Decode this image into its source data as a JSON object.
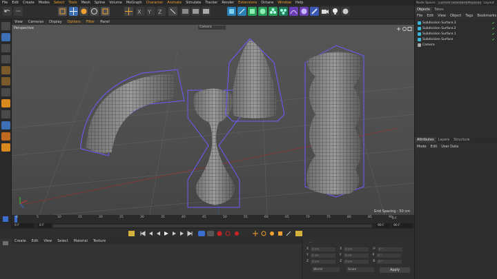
{
  "menubar": {
    "items": [
      "File",
      "Edit",
      "Create",
      "Modes",
      "Select",
      "Tools",
      "Mesh",
      "Spline",
      "Volume",
      "MoGraph",
      "Character",
      "Animate",
      "Simulate",
      "Tracker",
      "Render",
      "Extensions",
      "Octane",
      "Window",
      "Help"
    ],
    "highlighted": [
      "Select",
      "Tools",
      "Character",
      "Animate",
      "Extensions",
      "Window"
    ],
    "node_space_label": "Node Space:",
    "node_space_value": "Current (Standard/Physical)",
    "layout_label": "Layout"
  },
  "viewport": {
    "menus": [
      "View",
      "Cameras",
      "Display",
      "Options",
      "Filter",
      "Panel"
    ],
    "highlighted": [
      "Options",
      "Filter"
    ],
    "label": "Perspective",
    "camera_select": "Camera",
    "grid_spacing": "Grid Spacing : 50 cm"
  },
  "timeline": {
    "ticks": [
      "0",
      "5",
      "10",
      "15",
      "20",
      "25",
      "30",
      "35",
      "40",
      "45",
      "50",
      "55",
      "60",
      "65",
      "70",
      "75",
      "80",
      "85",
      "90"
    ],
    "current_frame": "0 F",
    "start": "0 F",
    "start2": "0 F",
    "end": "90 F",
    "end2": "90 F"
  },
  "material_bar": {
    "menus": [
      "Create",
      "Edit",
      "View",
      "Select",
      "Material",
      "Texture"
    ]
  },
  "coordinates": {
    "rows": [
      {
        "a": "X",
        "av": "0 cm",
        "b": "X",
        "bv": "0 cm",
        "c": "H",
        "cv": "0 °"
      },
      {
        "a": "Y",
        "av": "0 cm",
        "b": "Y",
        "bv": "0 cm",
        "c": "P",
        "cv": "0 °"
      },
      {
        "a": "Z",
        "av": "0 cm",
        "b": "Z",
        "bv": "0 cm",
        "c": "B",
        "cv": "0 °"
      }
    ],
    "mode1": "World",
    "mode2": "Scale",
    "apply": "Apply",
    "dots": "..."
  },
  "objects_panel": {
    "tabs": [
      "Objects",
      "Takes"
    ],
    "menus": [
      "File",
      "Edit",
      "View",
      "Object",
      "Tags",
      "Bookmarks"
    ],
    "items": [
      "Subdivision Surface.3",
      "Subdivision Surface.2",
      "Subdivision Surface.1",
      "Subdivision Surface",
      "Camera"
    ]
  },
  "attributes_panel": {
    "tabs": [
      "Attributes",
      "Layers",
      "Structure"
    ],
    "menus": [
      "Mode",
      "Edit",
      "User Data"
    ]
  },
  "colors": {
    "accent": "#f0a030",
    "object_icon": "#39b7d8",
    "cage": "#6a5cff"
  }
}
